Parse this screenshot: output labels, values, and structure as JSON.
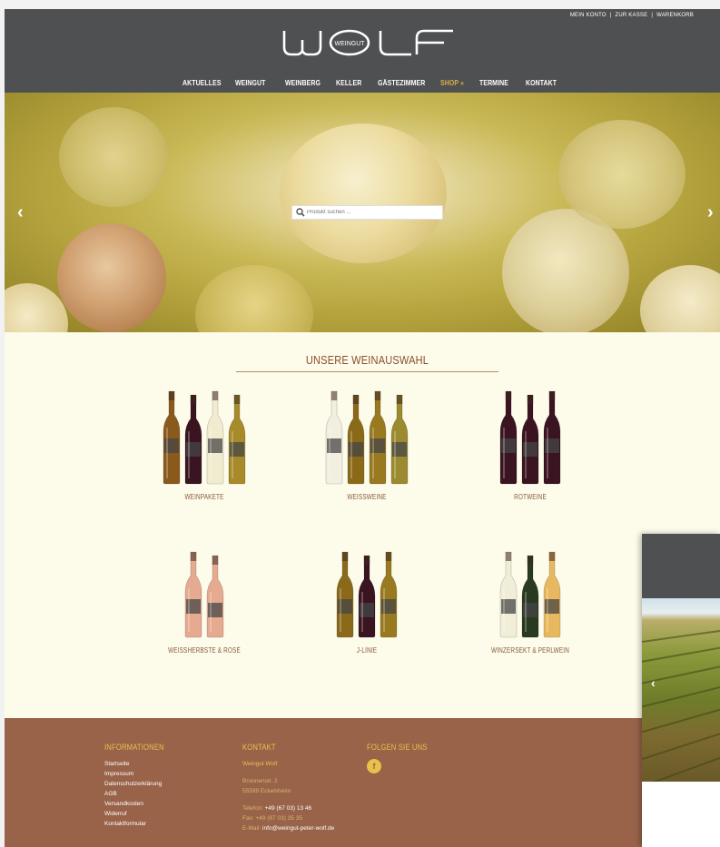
{
  "header": {
    "top_links": [
      "MEIN KONTO",
      "ZUR KASSE",
      "WARENKORB"
    ],
    "logo_left": "W",
    "logo_right": "LF",
    "logo_inner": "WEINGUT",
    "nav": [
      "AKTUELLES",
      "WEINGUT",
      "WEINBERG",
      "KELLER",
      "GÄSTEZIMMER",
      "SHOP »",
      "TERMINE",
      "KONTAKT"
    ],
    "active_nav": "SHOP »"
  },
  "hero": {
    "prev_arrow": "‹",
    "next_arrow": "›",
    "search_placeholder": "Produkt suchen ..."
  },
  "wines": {
    "heading": "UNSERE WEINAUSWAHL",
    "categories": [
      {
        "label": "WEINPAKETE",
        "bottles": [
          "#8a5a1c",
          "#3a1420",
          "#f1ecd0",
          "#a78a2a"
        ]
      },
      {
        "label": "WEISSWEINE",
        "bottles": [
          "#f2efe0",
          "#8a6a18",
          "#9a7a20",
          "#9c8a30"
        ]
      },
      {
        "label": "ROTWEINE",
        "bottles": [
          "#3a1420",
          "#3a1420",
          "#3a1420"
        ]
      },
      {
        "label": "WEISSHERBSTE & ROSÉ",
        "bottles": [
          "#e6aa90",
          "#e6aa90"
        ]
      },
      {
        "label": "J-LINIE",
        "bottles": [
          "#8a6a1a",
          "#3a1420",
          "#9a7a20"
        ]
      },
      {
        "label": "WINZERSEKT & PERLWEIN",
        "bottles": [
          "#f1eed8",
          "#2a3a20",
          "#e8b860"
        ]
      }
    ]
  },
  "footer": {
    "info": {
      "title": "INFORMATIONEN",
      "links": [
        "Startseite",
        "Impressum",
        "Datenschutzerklärung",
        "AGB",
        "Versandkosten",
        "Widerruf",
        "Kontaktformular"
      ]
    },
    "contact": {
      "title": "KONTAKT",
      "name": "Weingut Wolf",
      "street": "Brunnenstr. 2",
      "city": "55599 Eckelsheim",
      "phone_label": "Telefon:",
      "phone": "+49 (67 03) 13 46",
      "fax": "Fax: +49 (67 03) 35 35",
      "email_label": "E-Mail:",
      "email": "info@weingut-peter-wolf.de"
    },
    "social": {
      "title": "FOLGEN SIE UNS",
      "facebook_icon": "facebook-icon",
      "facebook_glyph": "f"
    }
  },
  "popup": {
    "arrow": "‹"
  },
  "colors": {
    "header_bg": "#4f5052",
    "page_bg": "#fdfbea",
    "footer_bg": "#996349",
    "accent_gold": "#e8c14a",
    "heading_brown": "#8a4f2d"
  }
}
